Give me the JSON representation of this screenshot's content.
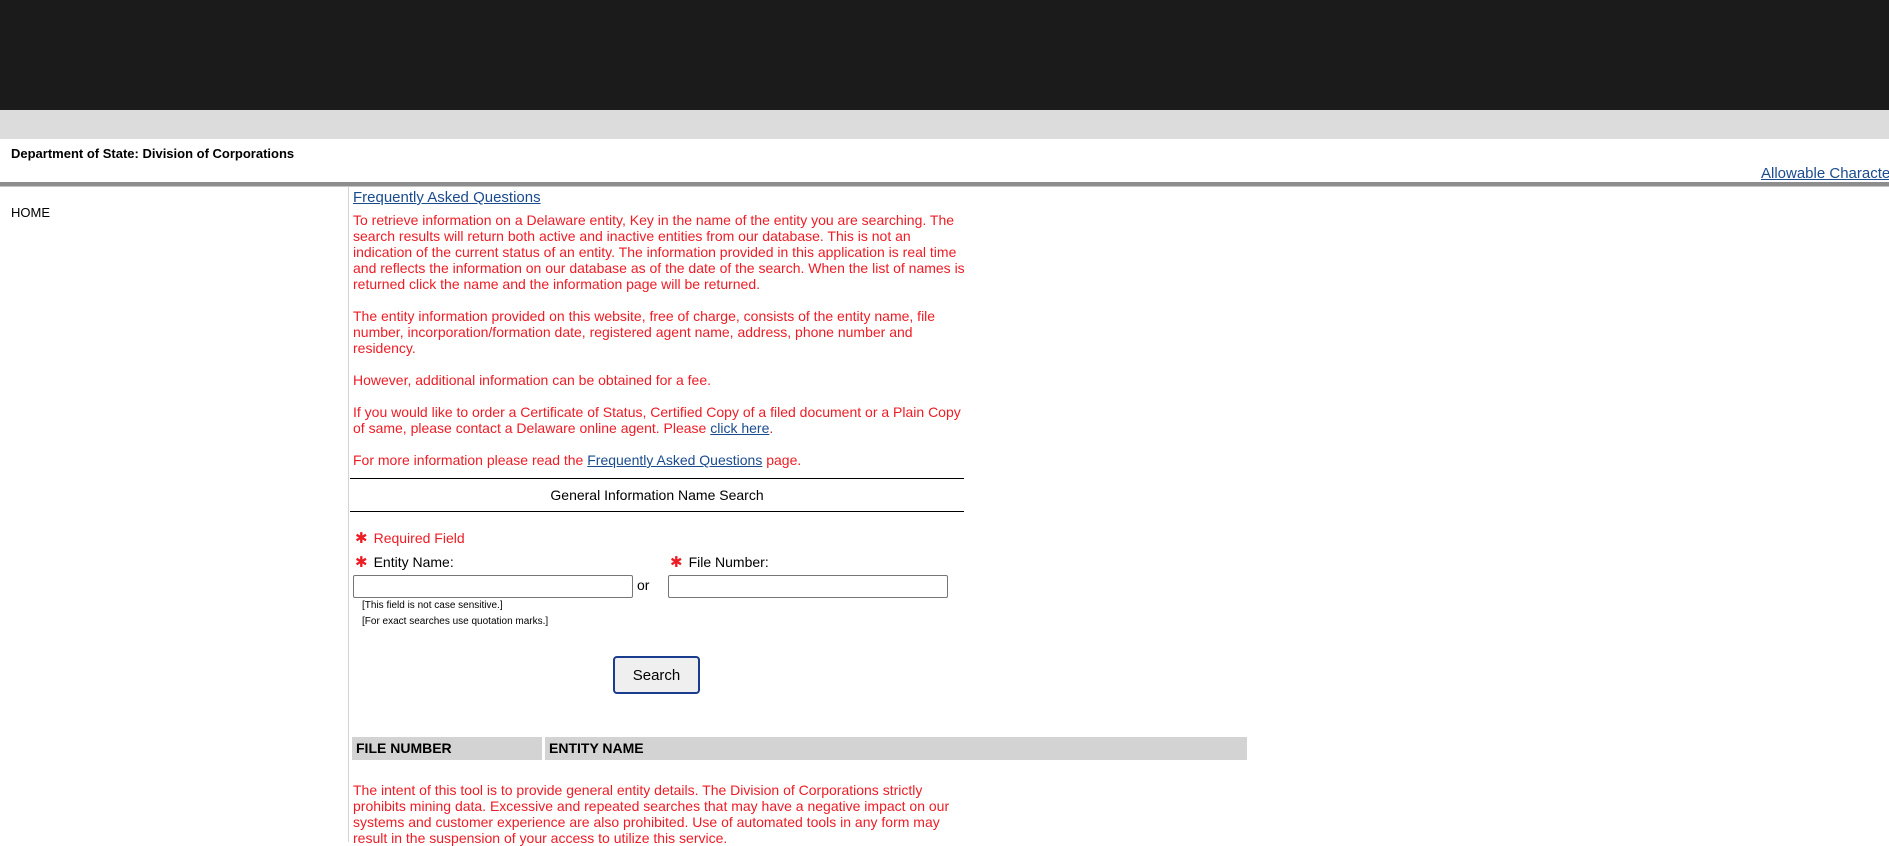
{
  "header": {
    "dept_title": "Department of State: Division of Corporations",
    "allowable_link": "Allowable Characters"
  },
  "nav": {
    "home": "HOME"
  },
  "intro": {
    "faq_link": "Frequently Asked Questions",
    "p1": "To retrieve information on a Delaware entity, Key in the name of the entity you are searching. The search results will return both active and inactive entities from our database. This is not an indication of the current status of an entity. The information provided in this application is real time and reflects the information on our database as of the date of the search. When the list of names is returned click the name and the information page will be returned.",
    "p2": "The entity information provided on this website, free of charge, consists of the entity name, file number, incorporation/formation date, registered agent name, address, phone number and residency.",
    "p3": "However, additional information can be obtained for a fee.",
    "p4_before": "If you would like to order a Certificate of Status, Certified Copy of a filed document or a Plain Copy of same, please contact a Delaware online agent. Please ",
    "p4_link": "click here",
    "p4_after": ".",
    "p5_before": "For more information please read the ",
    "p5_link": "Frequently Asked Questions",
    "p5_after": " page."
  },
  "search": {
    "section_title": "General Information Name Search",
    "required_label": "Required Field",
    "entity_label": "Entity Name:",
    "entity_value": "",
    "or_text": "or",
    "file_label": "File Number:",
    "file_value": "",
    "hint1": "[This field is not case sensitive.]",
    "hint2": "[For exact searches use quotation marks.]",
    "button": "Search",
    "required_icon": "asterisk-icon",
    "required_color": "#ee1c25"
  },
  "results": {
    "col_file": "FILE NUMBER",
    "col_entity": "ENTITY NAME"
  },
  "disclaimer": "The intent of this tool is to provide general entity details. The Division of Corporations strictly prohibits mining data. Excessive and repeated searches that may have a negative impact on our systems and customer experience are also prohibited. Use of automated tools in any form may result in the suspension of your access to utilize this service."
}
